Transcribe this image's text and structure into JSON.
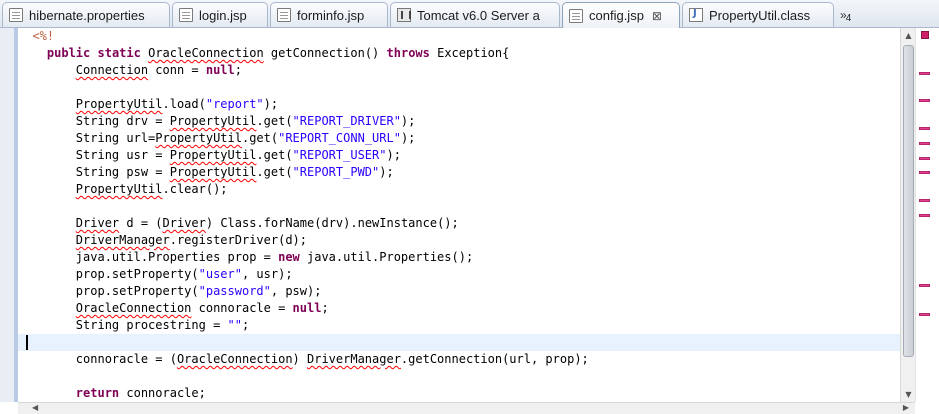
{
  "tabs": [
    {
      "label": "hibernate.properties",
      "icon": "properties-file-icon",
      "active": false
    },
    {
      "label": "login.jsp",
      "icon": "jsp-file-icon",
      "active": false
    },
    {
      "label": "forminfo.jsp",
      "icon": "jsp-file-icon",
      "active": false
    },
    {
      "label": "Tomcat v6.0 Server a",
      "icon": "server-icon",
      "active": false
    },
    {
      "label": "config.jsp",
      "icon": "jsp-file-icon",
      "active": true
    },
    {
      "label": "PropertyUtil.class",
      "icon": "java-class-icon",
      "active": false
    }
  ],
  "close_glyph": "⊠",
  "overflow": {
    "chevron": "»",
    "count": "4"
  },
  "code": {
    "line_1_tag": "<%!",
    "line_2": {
      "kw1": "public",
      "kw2": "static",
      "type": "OracleConnection",
      "method": " getConnection() ",
      "kw3": "throws",
      "rest": " Exception{"
    },
    "line_3": {
      "type": "Connection",
      "mid": " conn = ",
      "kw": "null",
      "end": ";"
    },
    "line_5": {
      "type": "PropertyUtil",
      "mid": ".load(",
      "str": "\"report\"",
      "end": ");"
    },
    "line_6": {
      "pre": "String drv = ",
      "type": "PropertyUtil",
      "mid": ".get(",
      "str": "\"REPORT_DRIVER\"",
      "end": ");"
    },
    "line_7": {
      "pre": "String url=",
      "type": "PropertyUtil",
      "mid": ".get(",
      "str": "\"REPORT_CONN_URL\"",
      "end": ");"
    },
    "line_8": {
      "pre": "String usr = ",
      "type": "PropertyUtil",
      "mid": ".get(",
      "str": "\"REPORT_USER\"",
      "end": ");"
    },
    "line_9": {
      "pre": "String psw = ",
      "type": "PropertyUtil",
      "mid": ".get(",
      "str": "\"REPORT_PWD\"",
      "end": ");"
    },
    "line_10": {
      "type": "PropertyUtil",
      "rest": ".clear();"
    },
    "line_12": {
      "type1": "Driver",
      "mid1": " d = (",
      "type2": "Driver",
      "rest": ") Class.forName(drv).newInstance();"
    },
    "line_13": {
      "type": "DriverManager",
      "rest": ".registerDriver(d);"
    },
    "line_14": {
      "pre": "java.util.Properties prop = ",
      "kw": "new",
      "rest": " java.util.Properties();"
    },
    "line_15": {
      "pre": "prop.setProperty(",
      "str": "\"user\"",
      "rest": ", usr);"
    },
    "line_16": {
      "pre": "prop.setProperty(",
      "str": "\"password\"",
      "rest": ", psw);"
    },
    "line_17": {
      "type": "OracleConnection",
      "mid": " connoracle = ",
      "kw": "null",
      "end": ";"
    },
    "line_18": {
      "pre": "String procestring = ",
      "str": "\"\"",
      "end": ";"
    },
    "line_20": {
      "pre": "connoracle = (",
      "type1": "OracleConnection",
      "mid": ") ",
      "type2": "DriverManager",
      "rest": ".getConnection(url, prop);"
    },
    "line_22": {
      "kw": "return",
      "rest": " connoracle;"
    }
  },
  "colors": {
    "keyword": "#7f0055",
    "string": "#2a00ff",
    "jsp_tag": "#bf5f3f",
    "error_underline": "#ff0000",
    "error_marker": "#e4408f",
    "current_line": "#e8f2fe"
  }
}
